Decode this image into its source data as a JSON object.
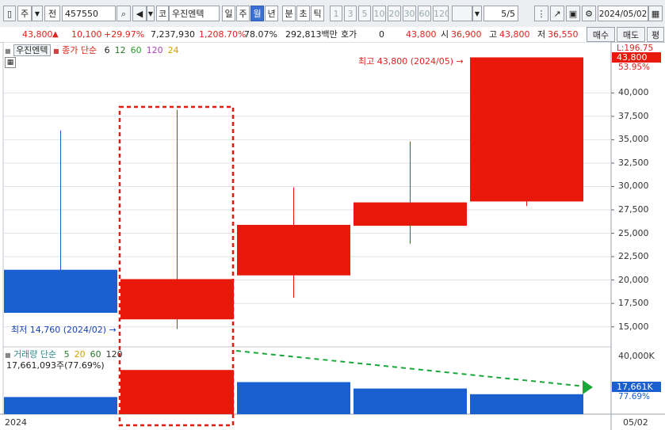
{
  "toolbar": {
    "market_label": "주",
    "prev_label": "전",
    "code_value": "457550",
    "stock_code_label": "코",
    "stock_name": "우진엔텍",
    "period_buttons": [
      "일",
      "주",
      "월",
      "년",
      "분",
      "초",
      "틱"
    ],
    "selected_period": "월",
    "interval_buttons": [
      "1",
      "3",
      "5",
      "10",
      "20",
      "30",
      "60",
      "120"
    ],
    "page_indicator": "5/5",
    "date_value": "2024/05/02"
  },
  "quote": {
    "price": "43,800",
    "change": "10,100",
    "change_pct": "+29.97%",
    "volume": "7,237,930",
    "volume_ratio": "1,208.70%",
    "turnover_pct": "78.07%",
    "amount": "292,813백만",
    "hoga_label": "호가",
    "hoga_value": "0",
    "current": "43,800",
    "open_label": "시",
    "open": "36,900",
    "high_label": "고",
    "high": "43,800",
    "low_label": "저",
    "low": "36,550",
    "buy_label": "매수",
    "sell_label": "매도",
    "eval_label": "평"
  },
  "price_panel": {
    "name_tag": "우진엔텍",
    "legend_title": "종가 단순",
    "ma_periods": [
      "6",
      "12",
      "60",
      "120",
      "24"
    ],
    "ma_colors": [
      "#222222",
      "#2a7a2a",
      "#2aa02a",
      "#b040c0",
      "#d8a000"
    ],
    "max_annotation": "최고 43,800 (2024/05)",
    "min_annotation": "최저 14,760 (2024/02)",
    "top_right_label": "L:196.75",
    "last_price_label": "43,800",
    "last_pct_label": "53.95%",
    "y_ticks": [
      "40,000",
      "37,500",
      "35,000",
      "32,500",
      "30,000",
      "27,500",
      "25,000",
      "22,500",
      "20,000",
      "17,500",
      "15,000"
    ]
  },
  "volume_panel": {
    "legend_title": "거래량 단순",
    "ma_periods": [
      "5",
      "20",
      "60",
      "120"
    ],
    "ma_colors": [
      "#2a7a2a",
      "#d8a000",
      "#2a7a2a",
      "#333333"
    ],
    "total_label": "17,661,093주(77.69%)",
    "y_top_label": "40,000K",
    "last_volume_label": "17,661K",
    "last_pct_label": "77.69%"
  },
  "x_axis": {
    "left_label": "2024",
    "right_label": "05/02"
  },
  "chart_data": {
    "type": "candlestick",
    "period": "monthly",
    "ylim": [
      12500,
      42500
    ],
    "candles": [
      {
        "open": 21100,
        "close": 16500,
        "high": 36000,
        "low": 16500,
        "color": "#1a5fd0"
      },
      {
        "open": 15800,
        "close": 20100,
        "high": 38200,
        "low": 14760,
        "color": "#e8190a"
      },
      {
        "open": 20500,
        "close": 25900,
        "high": 29900,
        "low": 18100,
        "color": "#e8190a"
      },
      {
        "open": 25800,
        "close": 28300,
        "high": 34800,
        "low": 23900,
        "color": "#e8190a"
      },
      {
        "open": 28400,
        "close": 43800,
        "high": 43800,
        "low": 27900,
        "color": "#e8190a"
      }
    ],
    "volume": {
      "ylim": [
        0,
        40000
      ],
      "values": [
        12000,
        31000,
        22500,
        18000,
        14000
      ],
      "colors": [
        "#1a5fd0",
        "#e8190a",
        "#1a5fd0",
        "#1a5fd0",
        "#1a5fd0"
      ]
    }
  }
}
